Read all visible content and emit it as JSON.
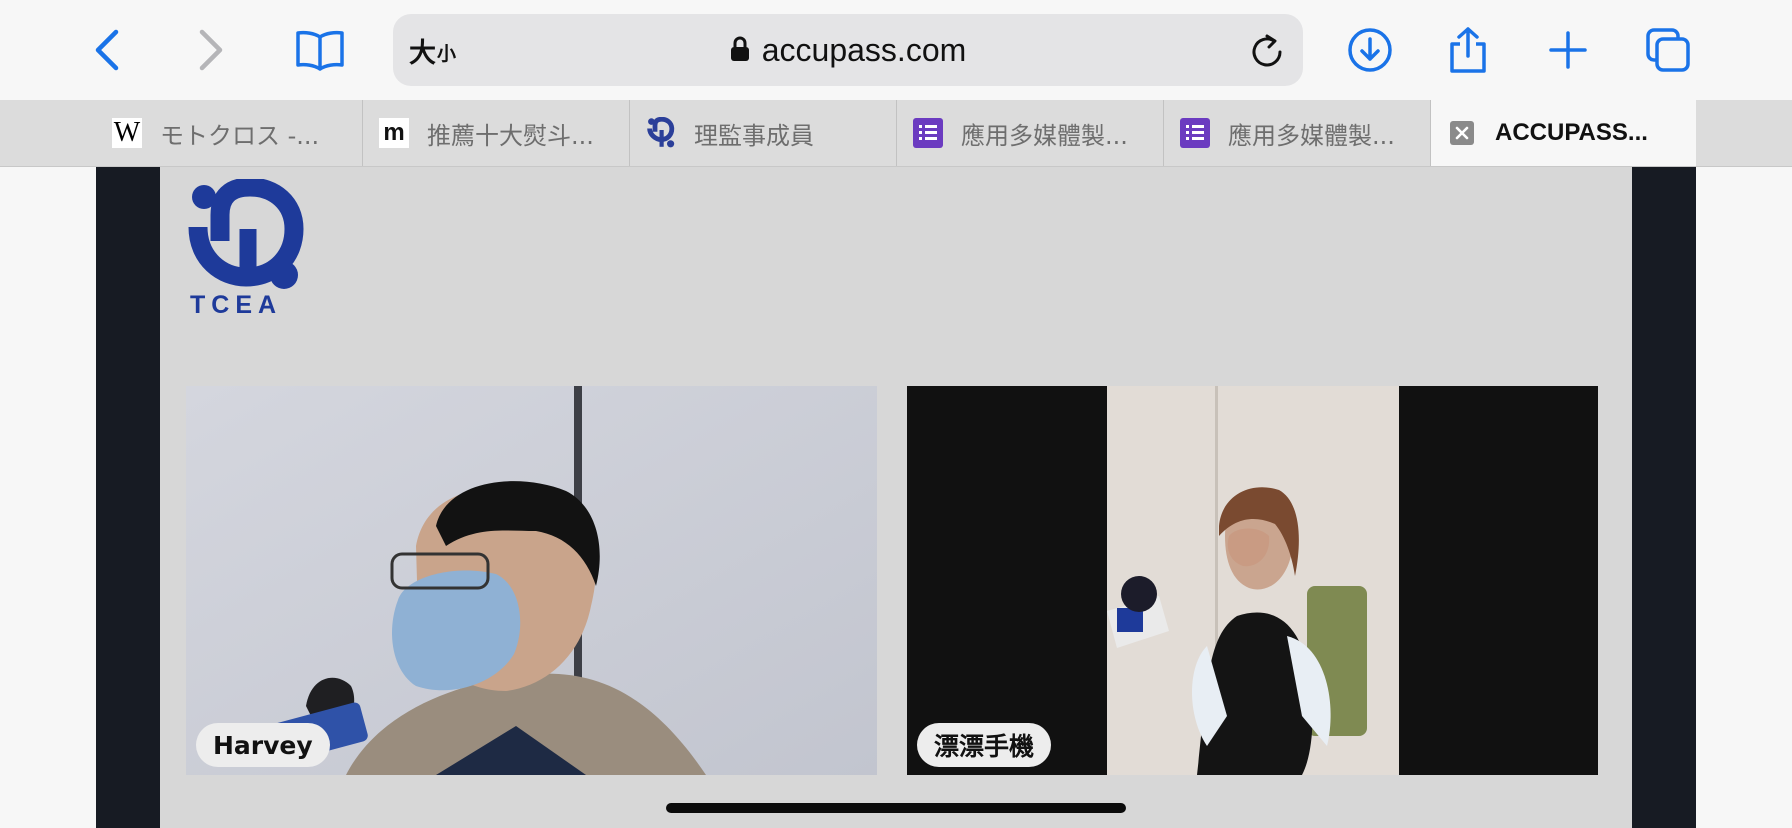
{
  "browser": {
    "text_size_large": "大",
    "text_size_small": "小",
    "address": "accupass.com",
    "accent_color": "#1a73e8",
    "icons": {
      "back": "chevron-left-icon",
      "forward": "chevron-right-icon",
      "bookmarks": "book-icon",
      "lock": "lock-icon",
      "reload": "reload-icon",
      "downloads": "download-icon",
      "share": "share-icon",
      "new_tab": "plus-icon",
      "tabs_overview": "tabs-icon"
    }
  },
  "tabs": [
    {
      "title": "モトクロス -...",
      "favicon": "wikipedia-w"
    },
    {
      "title": "推薦十大熨斗...",
      "favicon": "m-logo"
    },
    {
      "title": "理監事成員",
      "favicon": "tcea-logo"
    },
    {
      "title": "應用多媒體製...",
      "favicon": "forms-icon"
    },
    {
      "title": "應用多媒體製...",
      "favicon": "forms-icon"
    },
    {
      "title": "ACCUPASS...",
      "favicon": "close-icon",
      "active": true
    }
  ],
  "page": {
    "logo_text": "TCEA",
    "brand_color": "#1e3a9a",
    "participants": [
      {
        "name": "Harvey"
      },
      {
        "name": "漂漂手機"
      }
    ]
  }
}
